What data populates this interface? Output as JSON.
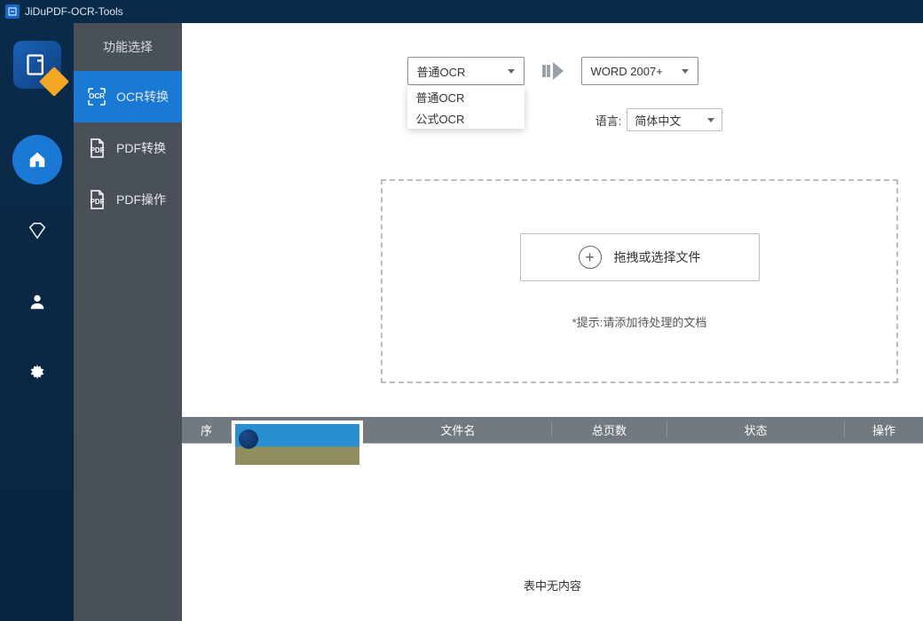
{
  "titlebar": {
    "title": "JiDuPDF-OCR-Tools"
  },
  "rail": {
    "items": [
      {
        "name": "home",
        "active": true
      },
      {
        "name": "diamond",
        "active": false
      },
      {
        "name": "user",
        "active": false
      },
      {
        "name": "settings",
        "active": false
      }
    ]
  },
  "sidebar": {
    "title": "功能选择",
    "items": [
      {
        "key": "ocr",
        "label": "OCR转换",
        "icon_text": "OCR",
        "active": true
      },
      {
        "key": "pdfconv",
        "label": "PDF转换",
        "icon_text": "PDF",
        "active": false
      },
      {
        "key": "pdfops",
        "label": "PDF操作",
        "icon_text": "PDF",
        "active": false
      }
    ]
  },
  "controls": {
    "source_select": {
      "value": "普通OCR",
      "options": [
        "普通OCR",
        "公式OCR"
      ]
    },
    "target_select": {
      "value": "WORD 2007+"
    },
    "lang_label_partial": "语言:",
    "lang_select": {
      "value": "简体中文"
    }
  },
  "dropzone": {
    "button_label": "拖拽或选择文件",
    "hint": "*提示:请添加待处理的文档"
  },
  "table": {
    "headers": {
      "idx": "序",
      "thumb": "",
      "name": "文件名",
      "pages": "总页数",
      "status": "状态",
      "ops": "操作"
    },
    "empty_message": "表中无内容"
  }
}
